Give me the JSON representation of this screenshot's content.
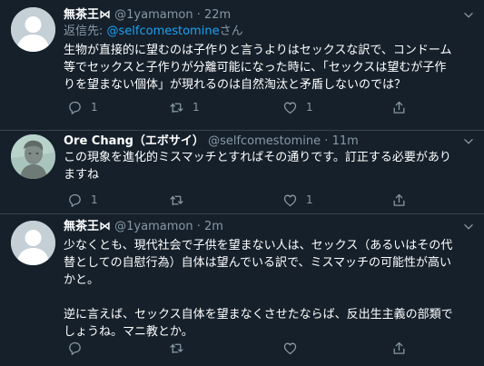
{
  "tweets": [
    {
      "name": "無茶王⋈",
      "handle": "@1yamamon",
      "dot": "·",
      "time": "22m",
      "reply_prefix": "返信先: ",
      "reply_mention": "@selfcomestomine",
      "reply_suffix": "さん",
      "text": "生物が直接的に望むのは子作りと言うよりはセックスな訳で、コンドーム\n等でセックスと子作りが分離可能になった時に、「セックスは望むが子作\nりを望まない個体」が現れるのは自然淘汰と矛盾しないのでは？",
      "counts": {
        "reply": "1",
        "retweet": "1",
        "like": "1"
      }
    },
    {
      "name": "Ore Chang（エボサイ）",
      "handle": "@selfcomestomine",
      "dot": "·",
      "time": "11m",
      "text": "この現象を進化的ミスマッチとすればその通りです。訂正する必要があり\nますね",
      "counts": {
        "reply": "1",
        "retweet": "",
        "like": "1"
      }
    },
    {
      "name": "無茶王⋈",
      "handle": "@1yamamon",
      "dot": "·",
      "time": "2m",
      "text": "少なくとも、現代社会で子供を望まない人は、セックス（あるいはその代\n替としての自慰行為）自体は望んでいる訳で、ミスマッチの可能性が高い\nかと。\n\n逆に言えば、セックス自体を望まなくさせたならば、反出生主義の部類で\nしょうね。マニ教とか。",
      "counts": {
        "reply": "",
        "retweet": "",
        "like": ""
      }
    }
  ],
  "icons": {
    "reply": "reply-icon",
    "retweet": "retweet-icon",
    "like": "heart-icon",
    "share": "share-icon",
    "caret": "chevron-down-icon"
  },
  "colors": {
    "background": "#15202b",
    "secondary_text": "#8899a6",
    "link": "#1da1f2",
    "divider": "#38444d"
  }
}
